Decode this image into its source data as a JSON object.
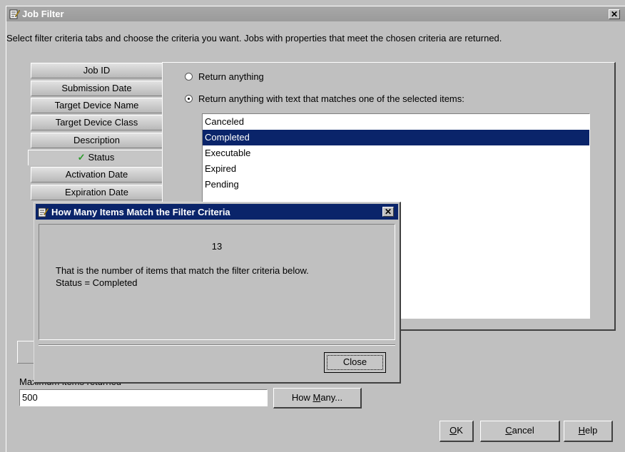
{
  "window": {
    "title": "Job Filter",
    "close_label": "✕"
  },
  "instructions": "Select filter criteria tabs and choose the criteria you want.  Jobs with properties that meet the chosen criteria are returned.",
  "tabs": [
    {
      "label": "Job ID"
    },
    {
      "label": "Submission Date"
    },
    {
      "label": "Target Device Name"
    },
    {
      "label": "Target Device Class"
    },
    {
      "label": "Description"
    },
    {
      "label": "Status",
      "check": "✓"
    },
    {
      "label": "Activation Date"
    },
    {
      "label": "Expiration Date"
    }
  ],
  "panel": {
    "radio_any": "Return anything",
    "radio_match": "Return anything with text that matches one of the selected items:",
    "list_items": [
      "Canceled",
      "Completed",
      "Executable",
      "Expired",
      "Pending"
    ],
    "selected_index": 1
  },
  "max_items": {
    "label": "Maximum items returned",
    "value": "500"
  },
  "buttons": {
    "how_many_pre": "How ",
    "how_many_u": "M",
    "how_many_post": "any...",
    "ok_u": "O",
    "ok_post": "K",
    "cancel_u": "C",
    "cancel_post": "ancel",
    "help_u": "H",
    "help_post": "elp"
  },
  "modal": {
    "title": "How Many Items Match the Filter Criteria",
    "count": "13",
    "message_line1": "That is the number of items that match the filter criteria below.",
    "message_line2": "Status = Completed",
    "close_label": "Close",
    "close_x": "✕"
  },
  "colors": {
    "selection": "#0a246a",
    "check": "#2a9a2a",
    "title_active": "#0a246a"
  }
}
